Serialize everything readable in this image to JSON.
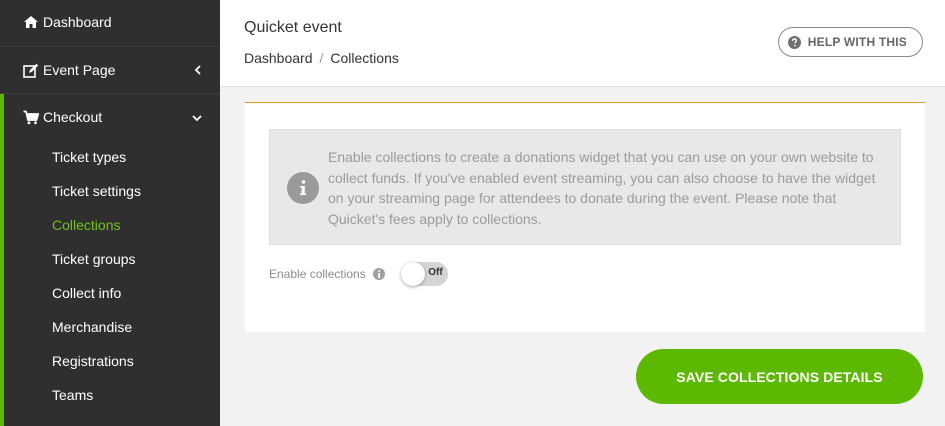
{
  "sidebar": {
    "dashboard": {
      "label": "Dashboard",
      "icon": "home-icon"
    },
    "event_page": {
      "label": "Event Page",
      "icon": "edit-icon",
      "chevron": "chevron-left-icon"
    },
    "checkout": {
      "label": "Checkout",
      "icon": "cart-icon",
      "chevron": "chevron-down-icon",
      "accent_color": "#5cb800",
      "items": [
        {
          "label": "Ticket types",
          "active": false
        },
        {
          "label": "Ticket settings",
          "active": false
        },
        {
          "label": "Collections",
          "active": true
        },
        {
          "label": "Ticket groups",
          "active": false
        },
        {
          "label": "Collect info",
          "active": false
        },
        {
          "label": "Merchandise",
          "active": false
        },
        {
          "label": "Registrations",
          "active": false
        },
        {
          "label": "Teams",
          "active": false
        }
      ]
    }
  },
  "header": {
    "event_title": "Quicket event",
    "breadcrumb": [
      "Dashboard",
      "Collections"
    ],
    "breadcrumb_separator": "/",
    "help_button": "HELP WITH THIS"
  },
  "content": {
    "info_text": "Enable collections to create a donations widget that you can use on your own website to collect funds. If you've enabled event streaming, you can also choose to have the widget on your streaming page for attendees to donate during the event. Please note that Quicket's fees apply to collections.",
    "toggle_label": "Enable collections",
    "toggle_state": "Off",
    "save_button": "SAVE COLLECTIONS DETAILS"
  },
  "colors": {
    "sidebar_bg": "#2f2f2f",
    "brand_green": "#5cb800",
    "active_item": "#6fc21c",
    "card_top_border": "#e89a1c"
  }
}
